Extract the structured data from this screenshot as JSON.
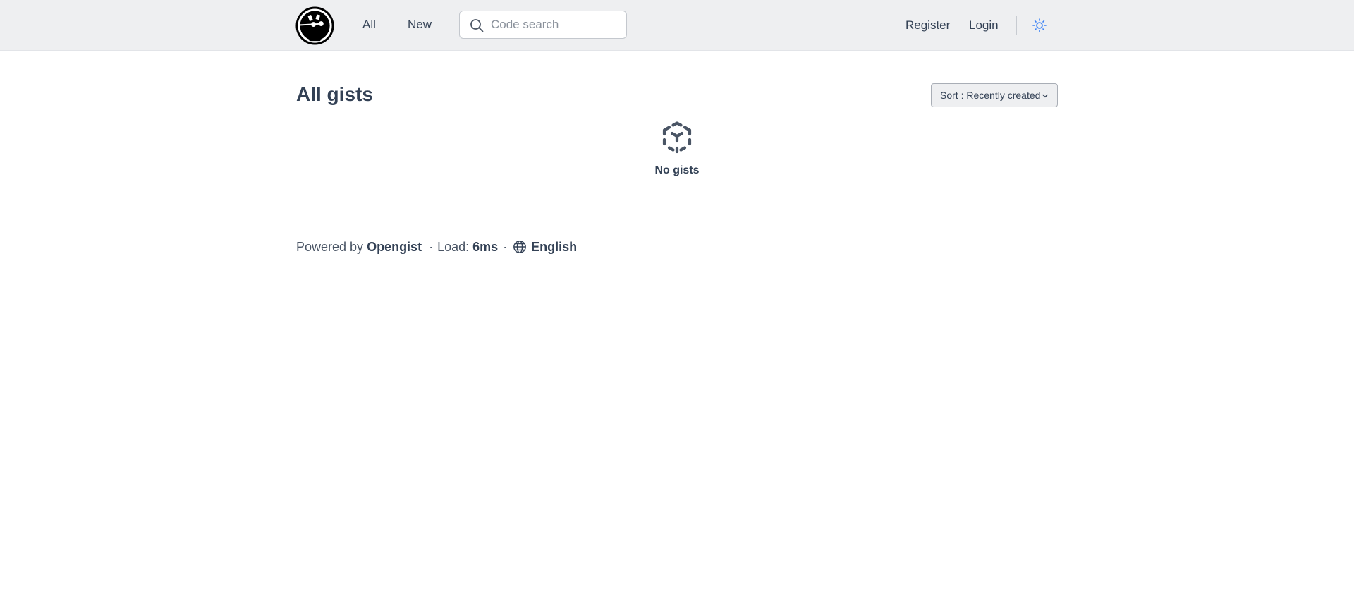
{
  "header": {
    "nav": {
      "all_label": "All",
      "new_label": "New"
    },
    "search": {
      "placeholder": "Code search",
      "value": ""
    },
    "register_label": "Register",
    "login_label": "Login",
    "icons": {
      "logo": "opengist-logo",
      "search": "search-icon",
      "theme": "sun-icon"
    },
    "accent_color": "#3b82f6"
  },
  "main": {
    "title": "All gists",
    "sort_label": "Sort : Recently created",
    "empty_state": {
      "icon": "cube-icon",
      "text": "No gists"
    }
  },
  "footer": {
    "powered_by_label": "Powered by",
    "brand": "Opengist",
    "load_label": "Load:",
    "load_value": "6ms",
    "language": "English",
    "language_icon": "globe-icon"
  }
}
